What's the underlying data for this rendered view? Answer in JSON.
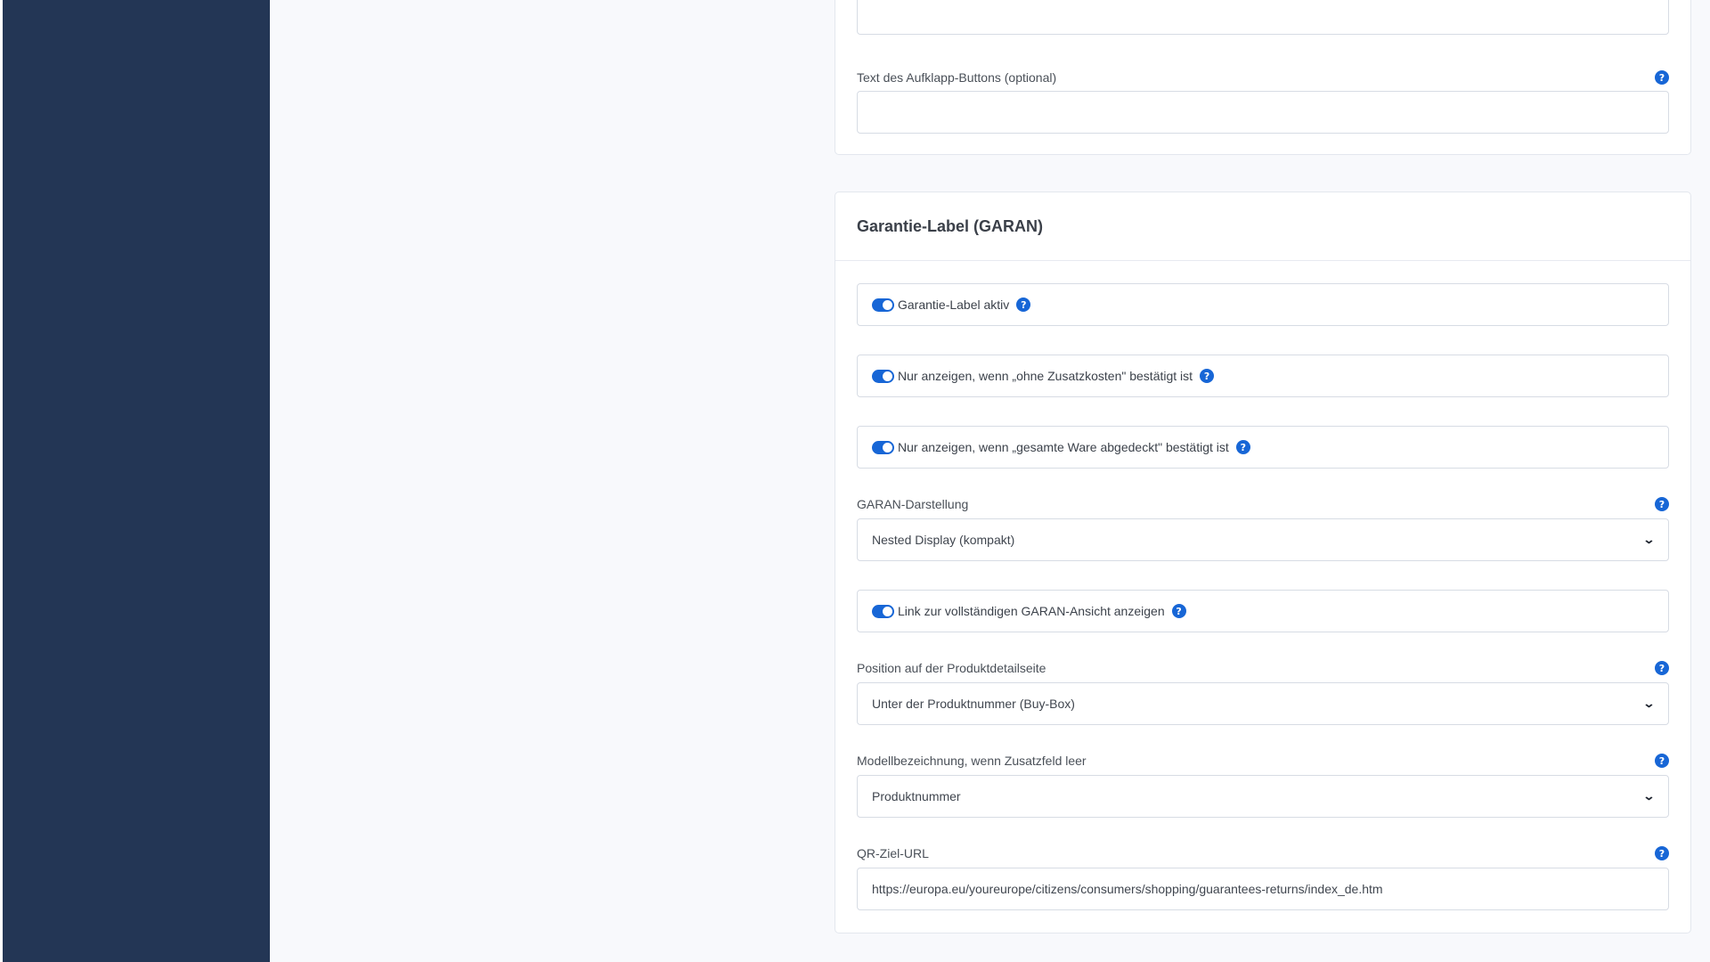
{
  "top_card": {
    "button_text_label": "Text des Aufklapp-Buttons (optional)",
    "button_text_value": ""
  },
  "garan": {
    "title": "Garantie-Label (GARAN)",
    "toggles": [
      {
        "label": "Garantie-Label aktiv",
        "on": true
      },
      {
        "label": "Nur anzeigen, wenn „ohne Zusatzkosten\" bestätigt ist",
        "on": true
      },
      {
        "label": "Nur anzeigen, wenn „gesamte Ware abgedeckt\" bestätigt ist",
        "on": true
      },
      {
        "label": "Link zur vollständigen GARAN-Ansicht anzeigen",
        "on": true
      }
    ],
    "display": {
      "label": "GARAN-Darstellung",
      "value": "Nested Display (kompakt)"
    },
    "position": {
      "label": "Position auf der Produktdetailseite",
      "value": "Unter der Produktnummer (Buy-Box)"
    },
    "model": {
      "label": "Modellbezeichnung, wenn Zusatzfeld leer",
      "value": "Produktnummer"
    },
    "qr": {
      "label": "QR-Ziel-URL",
      "value": "https://europa.eu/youreurope/citizens/consumers/shopping/guarantees-returns/index_de.htm"
    }
  },
  "icons": {
    "help": "?",
    "chevron": "⌄"
  },
  "colors": {
    "sidebar": "#233655",
    "accent": "#1766d6"
  }
}
